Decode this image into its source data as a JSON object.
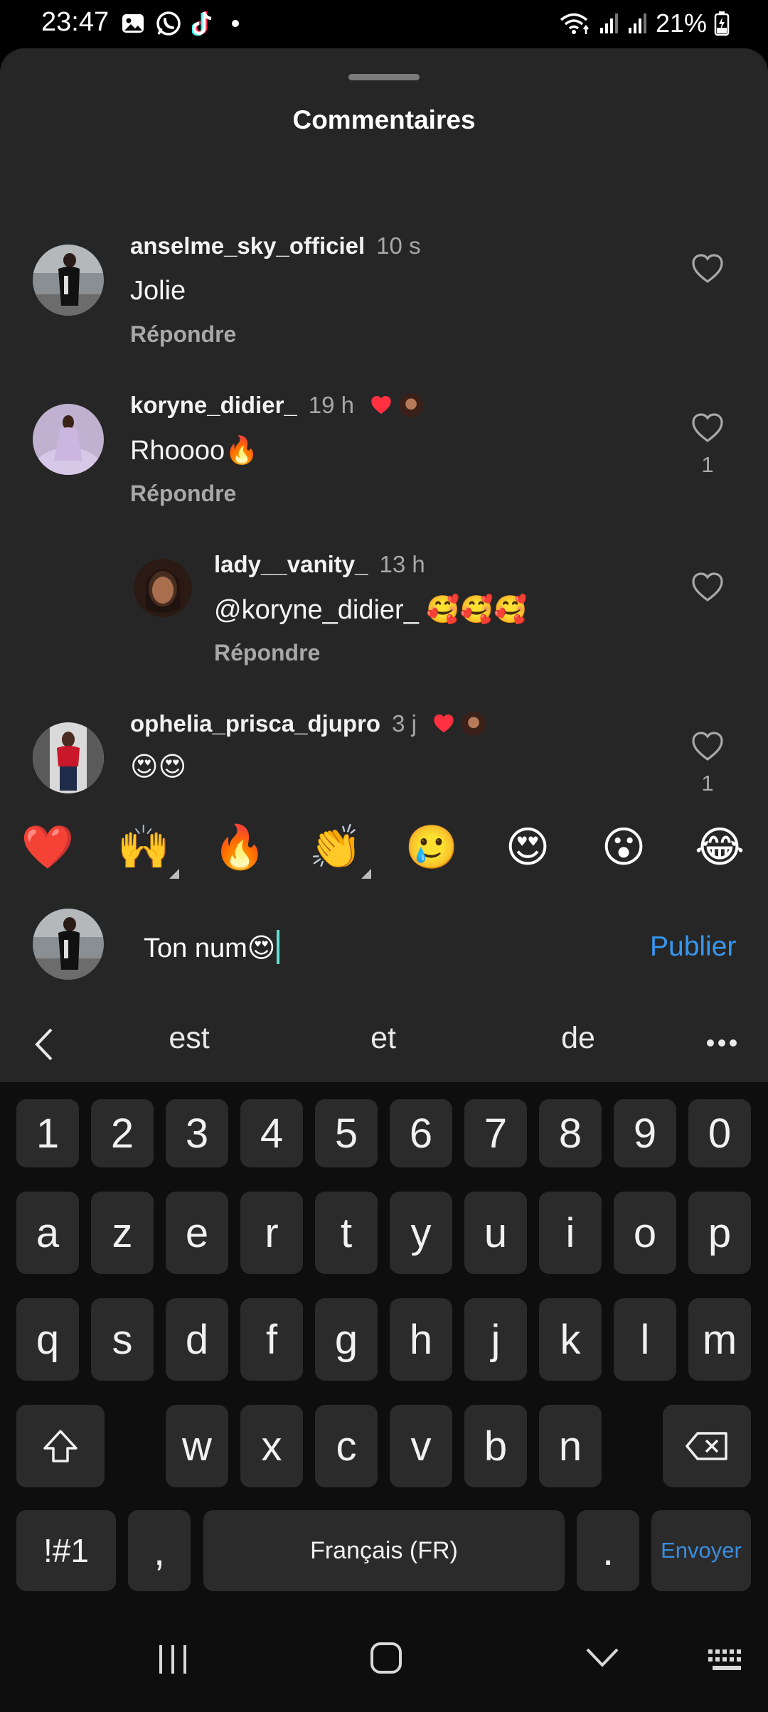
{
  "status_bar": {
    "time": "23:47",
    "battery": "21%",
    "icons": [
      "gallery-icon",
      "whatsapp-icon",
      "tiktok-icon",
      "notification-dot",
      "wifi-icon",
      "signal-icon",
      "signal-icon",
      "battery-charging-icon"
    ]
  },
  "sheet": {
    "title": "Commentaires"
  },
  "comments": [
    {
      "username": "anselme_sky_officiel",
      "time": "10 s",
      "text": "Jolie",
      "reply_label": "Répondre",
      "likes": ""
    },
    {
      "username": "koryne_didier_",
      "time": "19 h",
      "text": "Rhoooo🔥",
      "reply_label": "Répondre",
      "likes": "1",
      "liked_by_author": true
    },
    {
      "username": "lady__vanity_",
      "time": "13 h",
      "text": "@koryne_didier_ 🥰🥰🥰",
      "reply_label": "Répondre",
      "likes": ""
    },
    {
      "username": "ophelia_prisca_djupro",
      "time": "3 j",
      "text": "😍😍",
      "likes": "1",
      "liked_by_author": true
    }
  ],
  "emoji_bar": [
    "❤️",
    "🙌",
    "🔥",
    "👏",
    "🥲",
    "😍",
    "😮",
    "😂"
  ],
  "composer": {
    "value": "Ton num😍",
    "publish_label": "Publier"
  },
  "suggestions": [
    "est",
    "et",
    "de"
  ],
  "keyboard": {
    "row1": [
      "1",
      "2",
      "3",
      "4",
      "5",
      "6",
      "7",
      "8",
      "9",
      "0"
    ],
    "row2": [
      "a",
      "z",
      "e",
      "r",
      "t",
      "y",
      "u",
      "i",
      "o",
      "p"
    ],
    "row3": [
      "q",
      "s",
      "d",
      "f",
      "g",
      "h",
      "j",
      "k",
      "l",
      "m"
    ],
    "row4": [
      "w",
      "x",
      "c",
      "v",
      "b",
      "n"
    ],
    "symbols_label": "!#1",
    "comma": ",",
    "space_label": "Français (FR)",
    "period": ".",
    "send_label": "Envoyer"
  },
  "colors": {
    "sheet_bg": "#262626",
    "accent_blue": "#3797f0",
    "heart_red": "#ff3040",
    "muted_text": "#a8a8a8",
    "keyboard_bg": "#0e0e0e",
    "key_bg": "#2b2b2b"
  }
}
